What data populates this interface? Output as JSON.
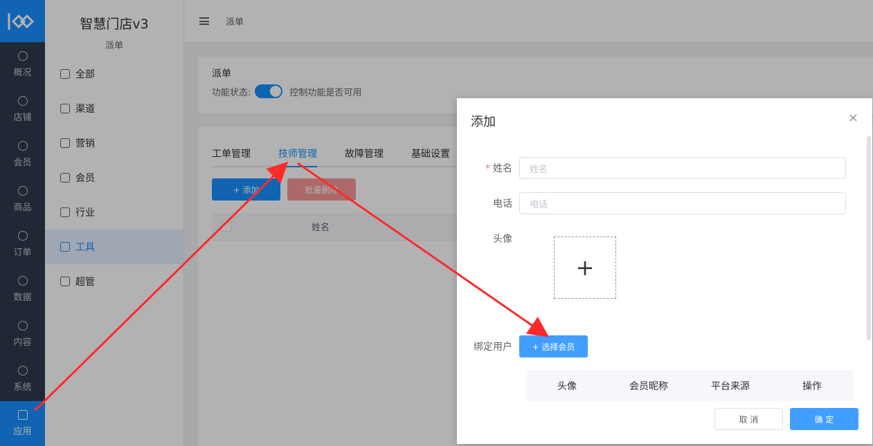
{
  "rail": {
    "items": [
      {
        "label": "概况",
        "icon": "dashboard-icon"
      },
      {
        "label": "店铺",
        "icon": "shop-icon"
      },
      {
        "label": "会员",
        "icon": "user-icon"
      },
      {
        "label": "商品",
        "icon": "box-icon"
      },
      {
        "label": "订单",
        "icon": "clipboard-icon"
      },
      {
        "label": "数据",
        "icon": "pie-icon"
      },
      {
        "label": "内容",
        "icon": "folder-icon"
      },
      {
        "label": "系统",
        "icon": "gear-icon"
      }
    ],
    "active": {
      "label": "应用",
      "icon": "cube-icon"
    }
  },
  "sidebar": {
    "title": "智慧门店v3",
    "subtitle": "派单",
    "items": [
      {
        "label": "全部"
      },
      {
        "label": "渠道"
      },
      {
        "label": "营销"
      },
      {
        "label": "会员"
      },
      {
        "label": "行业"
      },
      {
        "label": "工具"
      },
      {
        "label": "超管"
      }
    ]
  },
  "header": {
    "breadcrumb": "派单"
  },
  "feature": {
    "title": "派单",
    "status_label": "功能状态:",
    "switch_desc": "控制功能是否可用"
  },
  "tabs": [
    "工单管理",
    "技师管理",
    "故障管理",
    "基础设置"
  ],
  "toolbar": {
    "add": "+ 添加",
    "batch_delete": "批量删除"
  },
  "table": {
    "col_name": "姓名"
  },
  "dialog": {
    "title": "添加",
    "close": "×",
    "name_label": "姓名",
    "name_placeholder": "姓名",
    "phone_label": "电话",
    "phone_placeholder": "电话",
    "avatar_label": "头像",
    "upload_plus": "+",
    "bind_label": "绑定用户",
    "select_member": "+ 选择会员",
    "member_table": [
      "头像",
      "会员昵称",
      "平台来源",
      "操作"
    ],
    "cancel": "取 消",
    "confirm": "确 定"
  },
  "colors": {
    "primary": "#1890ff",
    "danger": "#f56c6c",
    "annotation": "#ff2a2a"
  }
}
